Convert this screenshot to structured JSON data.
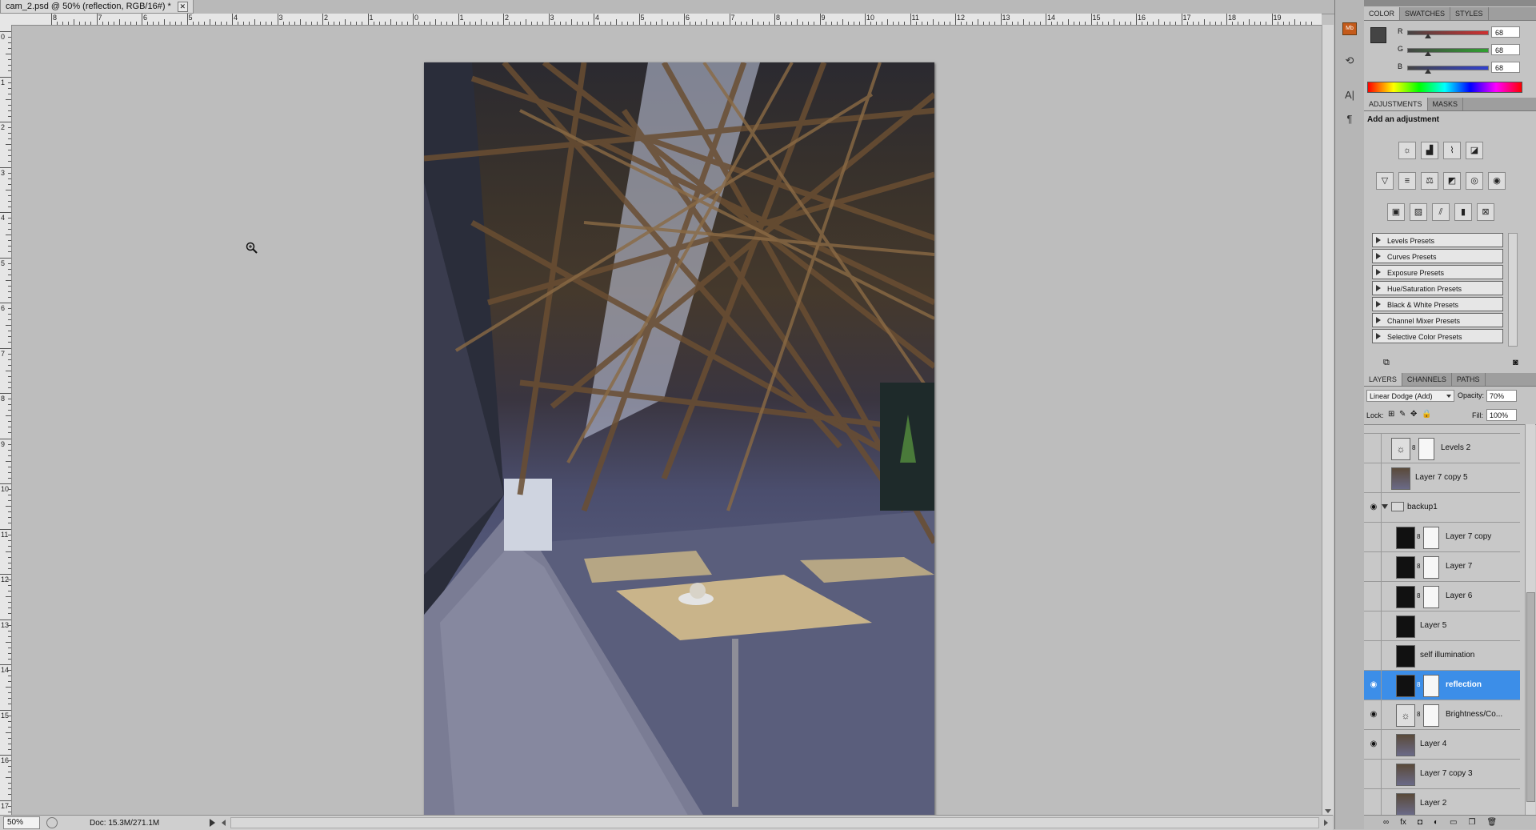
{
  "document": {
    "tab_title": "cam_2.psd @ 50% (reflection, RGB/16#) *",
    "close_glyph": "✕"
  },
  "rulers": {
    "top_labels": [
      "8",
      "7",
      "6",
      "5",
      "4",
      "3",
      "2",
      "1",
      "0",
      "1",
      "2",
      "3",
      "4",
      "5",
      "6",
      "7",
      "8",
      "9",
      "10",
      "11",
      "12",
      "13",
      "14",
      "15",
      "16",
      "17",
      "18",
      "19"
    ],
    "left_labels": [
      "0",
      "1",
      "2",
      "3",
      "4",
      "5",
      "6",
      "7",
      "8",
      "9",
      "10",
      "11",
      "12",
      "13",
      "14",
      "15",
      "16",
      "17"
    ]
  },
  "status": {
    "zoom": "50%",
    "doc_info": "Doc: 15.3M/271.1M"
  },
  "color_panel": {
    "tabs": [
      "COLOR",
      "SWATCHES",
      "STYLES"
    ],
    "channels": [
      {
        "label": "R",
        "value": "68",
        "color": "#d03030"
      },
      {
        "label": "G",
        "value": "68",
        "color": "#30a030"
      },
      {
        "label": "B",
        "value": "68",
        "color": "#3040d0"
      }
    ],
    "foreground": "#444444",
    "background": "#000000"
  },
  "adjustments_panel": {
    "tabs": [
      "ADJUSTMENTS",
      "MASKS"
    ],
    "heading": "Add an adjustment",
    "presets": [
      "Levels Presets",
      "Curves Presets",
      "Exposure Presets",
      "Hue/Saturation Presets",
      "Black & White Presets",
      "Channel Mixer Presets",
      "Selective Color Presets"
    ]
  },
  "layers_panel": {
    "tabs": [
      "LAYERS",
      "CHANNELS",
      "PATHS"
    ],
    "blend_mode": "Linear Dodge (Add)",
    "opacity_label": "Opacity:",
    "opacity": "70%",
    "lock_label": "Lock:",
    "fill_label": "Fill:",
    "fill": "100%",
    "selected_color": "#3c8ee8",
    "layers": [
      {
        "name": "Levels 2",
        "visible": false,
        "kind": "adjustment",
        "indent": false
      },
      {
        "name": "Layer 7 copy 5",
        "visible": false,
        "kind": "photo",
        "indent": false
      },
      {
        "name": "backup1",
        "visible": true,
        "kind": "group",
        "indent": false
      },
      {
        "name": "Layer 7 copy",
        "visible": false,
        "kind": "dark-mask",
        "indent": true
      },
      {
        "name": "Layer 7",
        "visible": false,
        "kind": "dark-mask",
        "indent": true
      },
      {
        "name": "Layer 6",
        "visible": false,
        "kind": "dark-mask",
        "indent": true
      },
      {
        "name": "Layer 5",
        "visible": false,
        "kind": "dark",
        "indent": true
      },
      {
        "name": "self illumination",
        "visible": false,
        "kind": "dark",
        "indent": true
      },
      {
        "name": "reflection",
        "visible": true,
        "kind": "dark-mask",
        "indent": true,
        "selected": true
      },
      {
        "name": "Brightness/Co...",
        "visible": true,
        "kind": "adjustment",
        "indent": true
      },
      {
        "name": "Layer 4",
        "visible": true,
        "kind": "photo",
        "indent": true
      },
      {
        "name": "Layer 7 copy 3",
        "visible": false,
        "kind": "photo",
        "indent": true
      },
      {
        "name": "Layer 2",
        "visible": false,
        "kind": "photo",
        "indent": true
      }
    ],
    "eye_glyph": "👁",
    "footer_icons": [
      "link-icon",
      "fx-icon",
      "mask-icon",
      "adjustment-icon",
      "group-icon",
      "new-layer-icon",
      "trash-icon"
    ]
  }
}
